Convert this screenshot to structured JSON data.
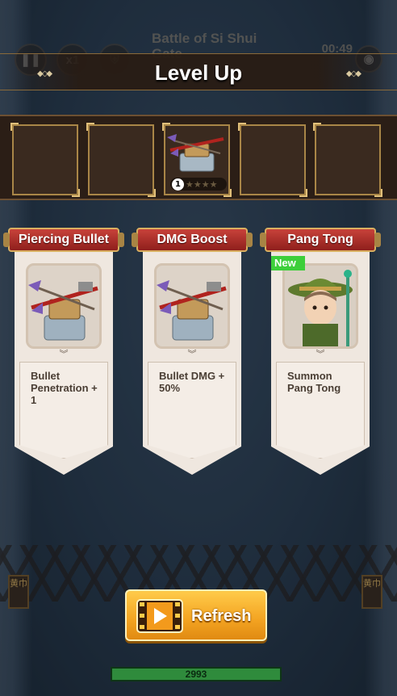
{
  "hud": {
    "pause_icon": "pause-icon",
    "speed_label": "x1",
    "battle_title": "Battle of Si Shui Gate",
    "timer": "00:49"
  },
  "levelup": {
    "title": "Level Up"
  },
  "slots": [
    {
      "filled": false
    },
    {
      "filled": false
    },
    {
      "filled": true,
      "icon": "ballista-icon",
      "level": "1",
      "stars": "★★★★"
    },
    {
      "filled": false
    },
    {
      "filled": false
    }
  ],
  "cards": [
    {
      "title": "Piercing Bullet",
      "description": "Bullet Penetration + 1",
      "image": "ballista-icon",
      "is_new": false
    },
    {
      "title": "DMG Boost",
      "description": "Bullet DMG + 50%",
      "image": "ballista-icon",
      "is_new": false
    },
    {
      "title": "Pang Tong",
      "description": "Summon Pang Tong",
      "image": "hero-portrait-icon",
      "is_new": true,
      "badge": "New"
    }
  ],
  "refresh": {
    "label": "Refresh",
    "icon": "film-play-icon"
  },
  "xp": {
    "value": "2993",
    "fill_fraction": 1.0
  },
  "side_banner_text": "黄巾",
  "colors": {
    "ribbon_red": "#b0302b",
    "button_gold": "#f3a321",
    "new_green": "#3dcf3a",
    "xp_green": "#2f8b3c"
  }
}
